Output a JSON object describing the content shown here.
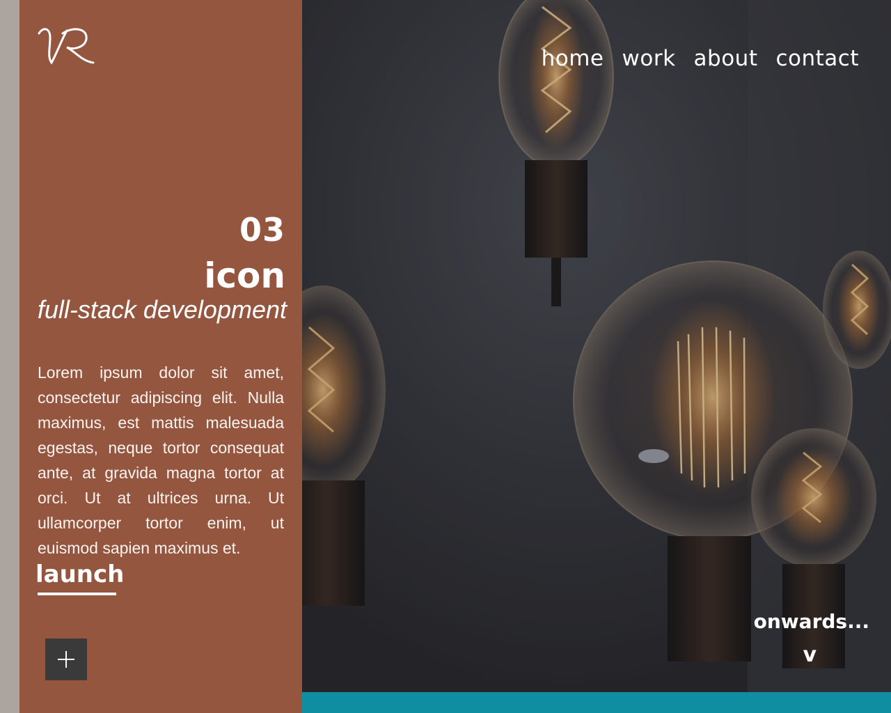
{
  "logo": {
    "icon": "vr-monogram-logo",
    "alt": "VR"
  },
  "project": {
    "number": "03",
    "name": "icon",
    "subtitle": "full-stack development",
    "description": "Lorem ipsum dolor sit amet, consectetur adipiscing elit. Nulla maximus, est mattis malesuada egestas, neque tortor consequat ante, at gravida magna tortor at orci. Ut at ultrices urna. Ut ullamcorper tortor enim, ut euismod sapien maximus et.",
    "launch_label": "launch"
  },
  "expand_button": {
    "icon": "plus-icon"
  },
  "nav": {
    "items": [
      {
        "label": "home"
      },
      {
        "label": "work"
      },
      {
        "label": "about"
      },
      {
        "label": "contact"
      }
    ]
  },
  "scroll_hint": {
    "label": "onwards...",
    "arrow": "v"
  },
  "colors": {
    "panel": "#955640",
    "left_strip": "#aba49f",
    "teal_bar": "#0e8ea0",
    "plus_button": "#3a3a3a",
    "text": "#ffffff"
  }
}
